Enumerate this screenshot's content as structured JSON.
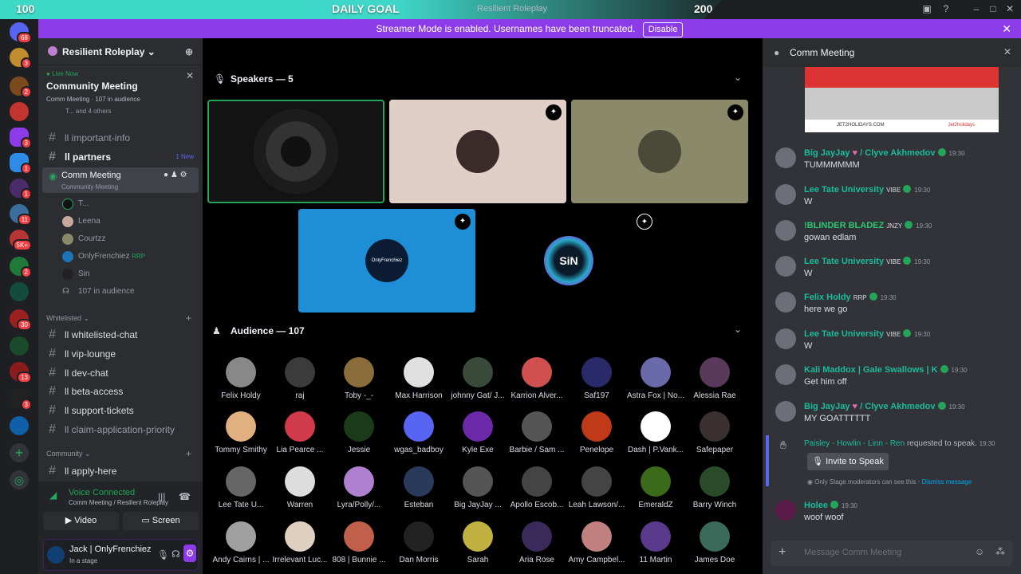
{
  "titlebar": {
    "title": "Resilient Roleplay",
    "goal_left": "100",
    "goal_label": "DAILY GOAL",
    "goal_right": "200"
  },
  "streamer": {
    "text": "Streamer Mode is enabled. Usernames have been truncated.",
    "disable": "Disable"
  },
  "rail": {
    "badges": [
      "68",
      "3",
      "2",
      "",
      "3",
      "1",
      "1",
      "11",
      "5K+",
      "2",
      "",
      "30",
      "",
      "13",
      "3",
      "",
      "",
      ""
    ]
  },
  "server": {
    "name": "Resilient Roleplay"
  },
  "live": {
    "label": "Live Now",
    "title": "Community Meeting",
    "sub": "Comm Meeting",
    "audience": "107 in audience",
    "others": "T... and 4 others"
  },
  "channels": {
    "c1": "ll important-info",
    "c2": "ll partners",
    "c2_new": "1 New",
    "stage": "Comm Meeting",
    "stage_sub": "Community Meeting",
    "speakers": [
      "T...",
      "Leena",
      "Courtzz",
      "OnlyFrenchiez",
      "Sin"
    ],
    "rrp": "RRP",
    "audience": "107 in audience",
    "cat1": "Whitelisted",
    "w1": "ll whitelisted-chat",
    "w2": "ll vip-lounge",
    "w3": "ll dev-chat",
    "w4": "ll beta-access",
    "w5": "ll support-tickets",
    "w6": "ll claim-application-priority",
    "cat2": "Community",
    "cm1": "ll apply-here"
  },
  "voice": {
    "status": "Voice Connected",
    "where": "Comm Meeting / Resilient Roleplay",
    "video": "Video",
    "screen": "Screen"
  },
  "user": {
    "name": "Jack | OnlyFrenchiez",
    "status": "In a stage"
  },
  "stage": {
    "speakers_label": "Speakers — 5",
    "audience_label": "Audience — 107",
    "tile_logo": "OnlyFrenchiez",
    "tile_sin": "SiN",
    "audience": [
      [
        "Felix Holdy",
        "raj",
        "Toby -_-",
        "Max Harrison",
        "johnny Gat/ J...",
        "Karrion Alver...",
        "Saf197",
        "Astra Fox | No...",
        "Alessia Rae"
      ],
      [
        "Tommy Smithy",
        "Lia Pearce ...",
        "Jessie",
        "wgas_badboy",
        "Kyle Exe",
        "Barbie / Sam ...",
        "Penelope",
        "Dash | P.Vank...",
        "Safepaper"
      ],
      [
        "Lee Tate U...",
        "Warren",
        "Lyra/Polly/...",
        "Esteban",
        "Big JayJay ...",
        "Apollo Escob...",
        "Leah Lawson/...",
        "EmeraldZ",
        "Barry Winch"
      ],
      [
        "Andy Cairns | ...",
        "Irrelevant Luc...",
        "808 | Bunnie ...",
        "Dan Morris",
        "Sarah",
        "Aria Rose",
        "Amy Campbel...",
        "11 Martin",
        "James Doe"
      ]
    ]
  },
  "chat": {
    "title": "Comm Meeting",
    "banner": "JET2HOLIDAYS.COM",
    "brand": "Jet2holidays",
    "messages": [
      {
        "name": "Big JayJay",
        "name2": "/ Clyve Akhmedov",
        "time": "19:30",
        "text": "TUMMMMMM"
      },
      {
        "name": "Lee Tate University",
        "tag": "VIBE",
        "time": "19:30",
        "text": "W"
      },
      {
        "name": "!BLINDER BLADEZ",
        "tag": "JNZY",
        "time": "19:30",
        "text": "gowan edlam"
      },
      {
        "name": "Lee Tate University",
        "tag": "VIBE",
        "time": "19:30",
        "text": "W"
      },
      {
        "name": "Felix Holdy",
        "tag": "RRP",
        "time": "19:30",
        "text": "here we go"
      },
      {
        "name": "Lee Tate University",
        "tag": "VIBE",
        "time": "19:30",
        "text": "W"
      },
      {
        "name": "Kali Maddox | Gale Swallows | K",
        "tag": "",
        "time": "19:30",
        "text": "Get him off"
      },
      {
        "name": "Big JayJay",
        "name2": "/ Clyve Akhmedov",
        "time": "19:30",
        "text": "MY GOATTTTTT"
      }
    ],
    "request_name": "Paisley - Howlin - Linn - Ren",
    "request_text": "requested to speak.",
    "request_time": "19:30",
    "invite": "Invite to Speak",
    "note": "Only Stage moderators can see this ·",
    "dismiss": "Dismiss message",
    "last_name": "Holee",
    "last_time": "19:30",
    "last_text": "woof woof",
    "placeholder": "Message Comm Meeting"
  },
  "colors": {
    "accent": "#5865f2",
    "streamer": "#8b3ce8",
    "teal": "#3dd9c5",
    "name_green": "#2dc770",
    "name_teal": "#1abc9c"
  }
}
